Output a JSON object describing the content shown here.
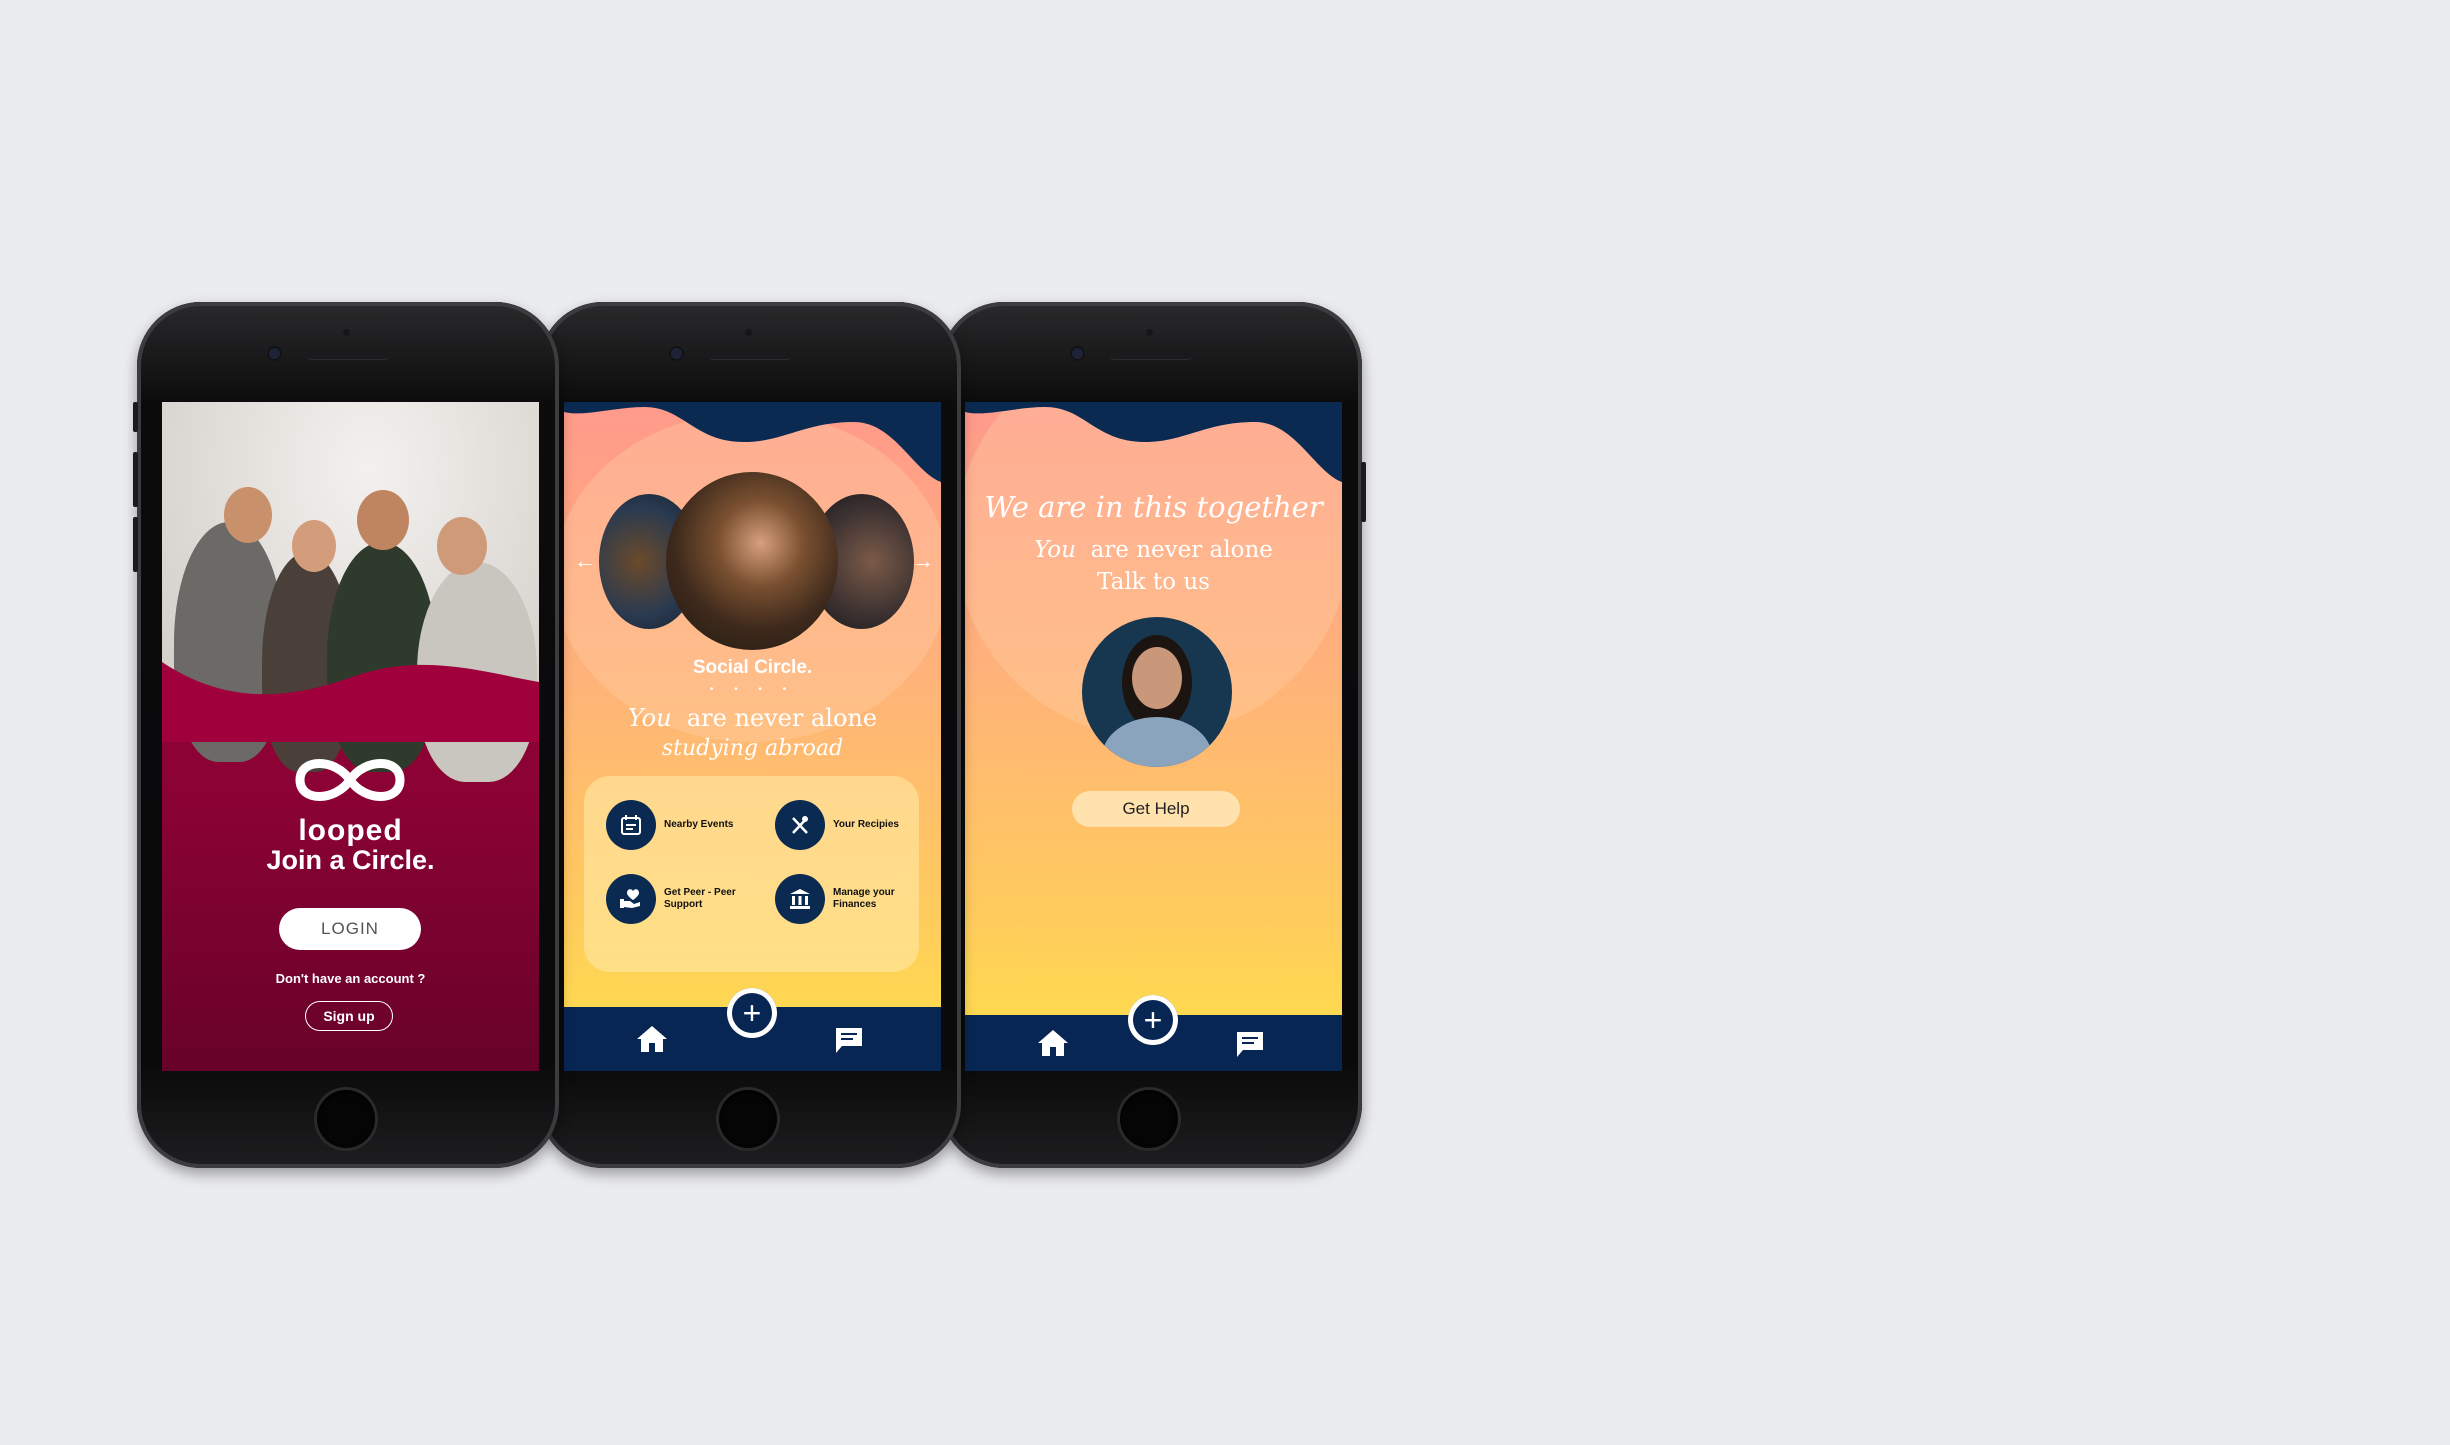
{
  "screen1": {
    "brand": "looped",
    "tagline": "Join a Circle.",
    "login_label": "LOGIN",
    "no_account": "Don't have an account ?",
    "signup_label": "Sign up",
    "accent": "#a0003c"
  },
  "screen2": {
    "title": "Social Circle.",
    "dots": "• • • •",
    "line1_em": "You",
    "line1_rest": "are never alone",
    "line2": "studying abroad",
    "menu": [
      {
        "icon": "calendar-icon",
        "label": "Nearby Events"
      },
      {
        "icon": "utensils-icon",
        "label": "Your Recipies"
      },
      {
        "icon": "heart-hand-icon",
        "label": "Get Peer - Peer Support"
      },
      {
        "icon": "bank-icon",
        "label": "Manage your Finances"
      }
    ]
  },
  "screen3": {
    "headline": "We are in this together",
    "line1_em": "You",
    "line1_rest": "are never alone",
    "line2": "Talk to us",
    "button": "Get Help"
  },
  "nav": {
    "fab": "+",
    "home_icon": "home-icon",
    "chat_icon": "chat-icon",
    "bar_color": "#082654"
  }
}
